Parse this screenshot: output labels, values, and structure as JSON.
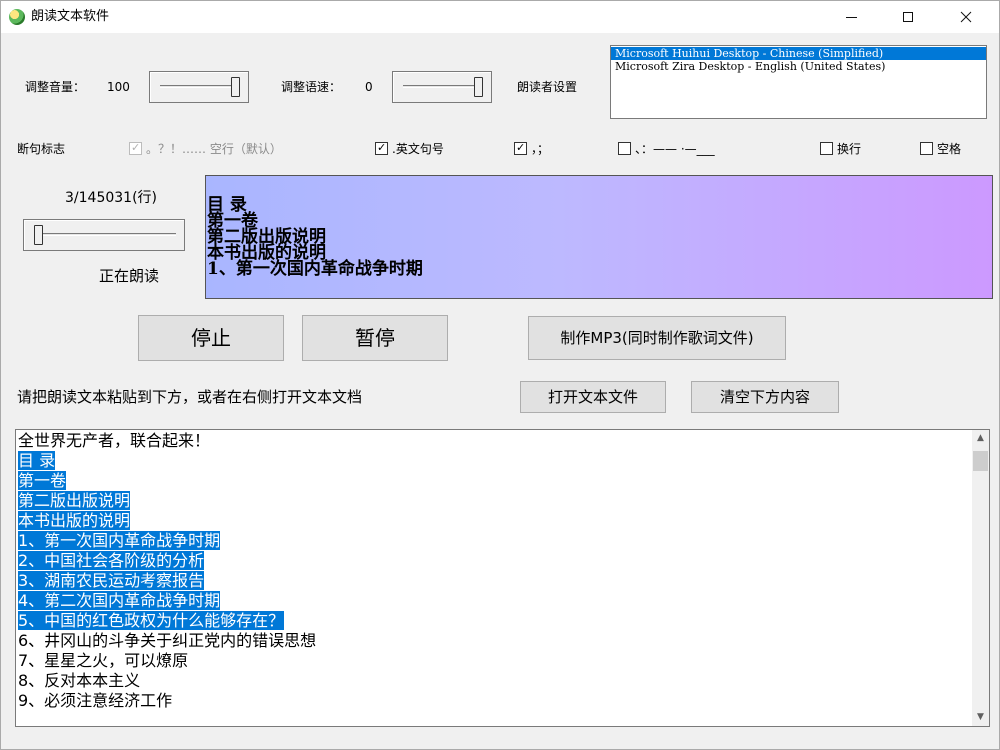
{
  "window": {
    "title": "朗读文本软件",
    "minimize": "—",
    "maximize": "☐",
    "close": "✕"
  },
  "volume": {
    "label": "调整音量：",
    "value": "100",
    "slider_level": 1.0
  },
  "speed": {
    "label": "调整语速：",
    "value": "0",
    "slider_level": 1.0
  },
  "reader": {
    "label": "朗读者设置",
    "voices": [
      "Microsoft Huihui Desktop - Chinese (Simplified)",
      "Microsoft Zira Desktop - English (United States)"
    ],
    "selected_index": 0
  },
  "punctuation": {
    "label": "断句标志",
    "options": [
      {
        "text": "。？！…… 空行（默认）",
        "checked": true,
        "disabled": true
      },
      {
        "text": ".英文句号",
        "checked": true,
        "disabled": false
      },
      {
        "text": "，；",
        "checked": true,
        "disabled": false
      },
      {
        "text": "、：—— ·—___",
        "checked": false,
        "disabled": false
      },
      {
        "text": "换行",
        "checked": false,
        "disabled": false
      },
      {
        "text": "空格",
        "checked": false,
        "disabled": false
      }
    ]
  },
  "progress": {
    "text": "3/145031(行)",
    "slider_level": 0.0,
    "status": "正在朗读"
  },
  "reading_panel": {
    "lines": [
      "目 录",
      "第一卷",
      "第二版出版说明",
      "本书出版的说明",
      "1、第一次国内革命战争时期"
    ]
  },
  "buttons": {
    "stop": "停止",
    "pause": "暂停",
    "make_mp3": "制作MP3(同时制作歌词文件)",
    "open_file": "打开文本文件",
    "clear": "清空下方内容"
  },
  "instruction": "请把朗读文本粘贴到下方，或者在右侧打开文本文档",
  "text_area": {
    "lines": [
      {
        "text": "全世界无产者，联合起来！",
        "highlighted": false
      },
      {
        "text": "目 录",
        "highlighted": true
      },
      {
        "text": "第一卷",
        "highlighted": true
      },
      {
        "text": "第二版出版说明",
        "highlighted": true
      },
      {
        "text": "本书出版的说明",
        "highlighted": true
      },
      {
        "text": "1、第一次国内革命战争时期",
        "highlighted": true
      },
      {
        "text": "2、中国社会各阶级的分析",
        "highlighted": true
      },
      {
        "text": "3、湖南农民运动考察报告",
        "highlighted": true
      },
      {
        "text": "4、第二次国内革命战争时期",
        "highlighted": true
      },
      {
        "text": "5、中国的红色政权为什么能够存在？",
        "highlighted": true
      },
      {
        "text": "6、井冈山的斗争关于纠正党内的错误思想",
        "highlighted": false
      },
      {
        "text": "7、星星之火，可以燎原",
        "highlighted": false
      },
      {
        "text": "8、反对本本主义",
        "highlighted": false
      },
      {
        "text": "9、必须注意经济工作",
        "highlighted": false
      }
    ],
    "scroll_up": "▲",
    "scroll_down": "▼"
  }
}
